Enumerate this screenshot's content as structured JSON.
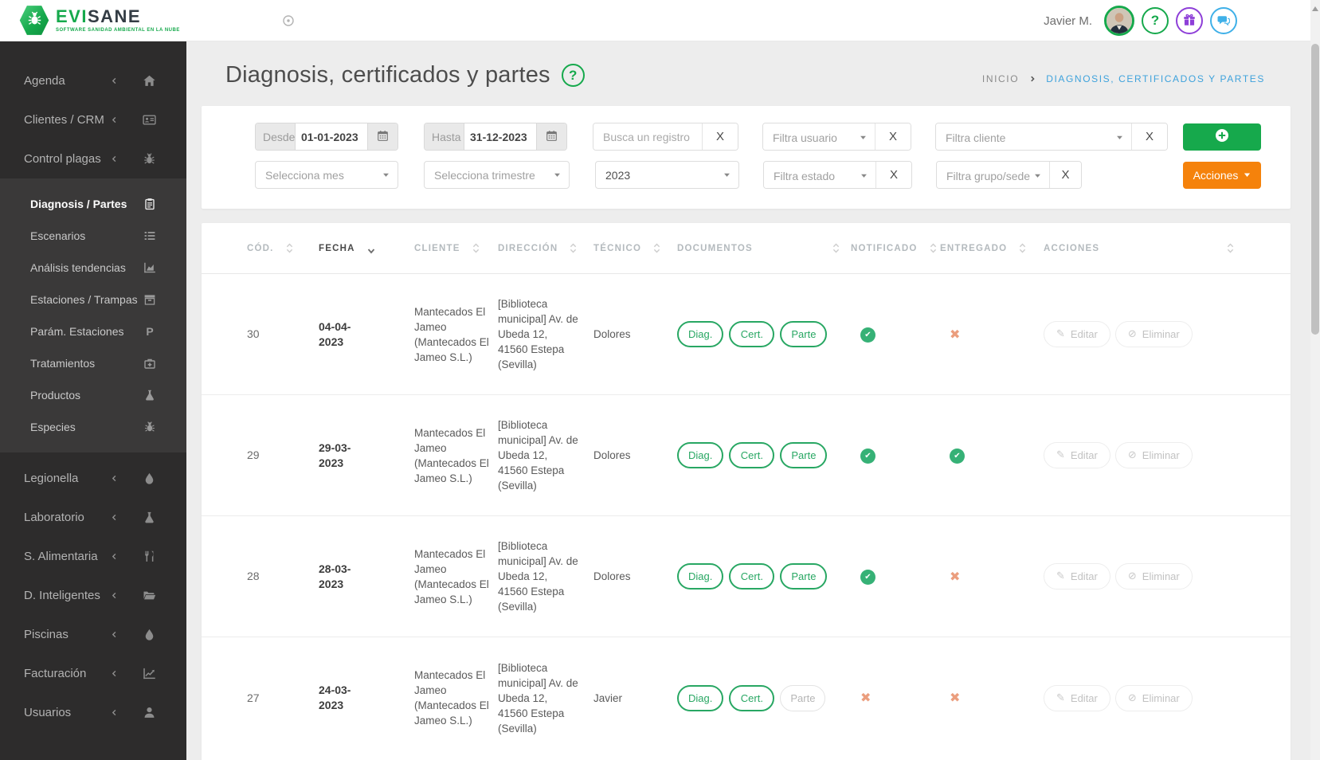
{
  "brand": {
    "name_left": "EVI",
    "name_right": "SANE",
    "tagline": "SOFTWARE SANIDAD AMBIENTAL EN LA NUBE"
  },
  "topbar": {
    "user_name": "Javier M."
  },
  "sidebar": {
    "main_items": [
      {
        "label": "Agenda",
        "icon": "home"
      },
      {
        "label": "Clientes / CRM",
        "icon": "idcard"
      },
      {
        "label": "Control plagas",
        "icon": "bug"
      }
    ],
    "sub_items": [
      {
        "label": "Diagnosis / Partes",
        "icon": "clipboard",
        "active": true
      },
      {
        "label": "Escenarios",
        "icon": "list"
      },
      {
        "label": "Análisis tendencias",
        "icon": "chart-area"
      },
      {
        "label": "Estaciones / Trampas",
        "icon": "box"
      },
      {
        "label": "Parám. Estaciones",
        "icon": "param-p"
      },
      {
        "label": "Tratamientos",
        "icon": "medkit"
      },
      {
        "label": "Productos",
        "icon": "flask"
      },
      {
        "label": "Especies",
        "icon": "bug"
      }
    ],
    "bottom_items": [
      {
        "label": "Legionella",
        "icon": "drop"
      },
      {
        "label": "Laboratorio",
        "icon": "flask"
      },
      {
        "label": "S. Alimentaria",
        "icon": "utensils"
      },
      {
        "label": "D. Inteligentes",
        "icon": "folder"
      },
      {
        "label": "Piscinas",
        "icon": "drop"
      },
      {
        "label": "Facturación",
        "icon": "chart-line"
      },
      {
        "label": "Usuarios",
        "icon": "user"
      }
    ]
  },
  "page": {
    "title": "Diagnosis, certificados y partes",
    "breadcrumb_home": "INICIO",
    "breadcrumb_current": "DIAGNOSIS, CERTIFICADOS Y PARTES"
  },
  "filters": {
    "desde_label": "Desde",
    "desde_value": "01-01-2023",
    "hasta_label": "Hasta",
    "hasta_value": "31-12-2023",
    "search_placeholder": "Busca un registro",
    "clear_label": "X",
    "usuario_placeholder": "Filtra usuario",
    "cliente_placeholder": "Filtra cliente",
    "mes_placeholder": "Selecciona mes",
    "trimestre_placeholder": "Selecciona trimestre",
    "anio_value": "2023",
    "estado_placeholder": "Filtra estado",
    "grupo_placeholder": "Filtra grupo/sede",
    "acciones_label": "Acciones"
  },
  "table": {
    "headers": {
      "cod": "CÓD.",
      "fecha": "FECHA",
      "cliente": "CLIENTE",
      "direccion": "DIRECCIÓN",
      "tecnico": "TÉCNICO",
      "documentos": "DOCUMENTOS",
      "notificado": "NOTIFICADO",
      "entregado": "ENTREGADO",
      "acciones": "ACCIONES"
    },
    "doc_labels": {
      "diag": "Diag.",
      "cert": "Cert.",
      "parte": "Parte"
    },
    "action_labels": {
      "editar": "Editar",
      "eliminar": "Eliminar"
    },
    "rows": [
      {
        "cod": "30",
        "fecha": "04-04-2023",
        "cliente": "Mantecados El Jameo (Mantecados El Jameo S.L.)",
        "direccion": "[Biblioteca municipal] Av. de Ubeda 12, 41560 Estepa (Sevilla)",
        "tecnico": "Dolores",
        "docs": {
          "diag": true,
          "cert": true,
          "parte": true
        },
        "notificado": true,
        "entregado": false
      },
      {
        "cod": "29",
        "fecha": "29-03-2023",
        "cliente": "Mantecados El Jameo (Mantecados El Jameo S.L.)",
        "direccion": "[Biblioteca municipal] Av. de Ubeda 12, 41560 Estepa (Sevilla)",
        "tecnico": "Dolores",
        "docs": {
          "diag": true,
          "cert": true,
          "parte": true
        },
        "notificado": true,
        "entregado": true
      },
      {
        "cod": "28",
        "fecha": "28-03-2023",
        "cliente": "Mantecados El Jameo (Mantecados El Jameo S.L.)",
        "direccion": "[Biblioteca municipal] Av. de Ubeda 12, 41560 Estepa (Sevilla)",
        "tecnico": "Dolores",
        "docs": {
          "diag": true,
          "cert": true,
          "parte": true
        },
        "notificado": true,
        "entregado": false
      },
      {
        "cod": "27",
        "fecha": "24-03-2023",
        "cliente": "Mantecados El Jameo (Mantecados El Jameo S.L.)",
        "direccion": "[Biblioteca municipal] Av. de Ubeda 12, 41560 Estepa (Sevilla)",
        "tecnico": "Javier",
        "docs": {
          "diag": true,
          "cert": true,
          "parte": false
        },
        "notificado": false,
        "entregado": false
      }
    ]
  },
  "colors": {
    "accent_green": "#16a94c",
    "accent_orange": "#f5820b",
    "link_blue": "#3ea2dc",
    "check_green": "#36b176",
    "cross_orange": "#eb9e7e",
    "sidebar_dark": "#2d2c2c"
  }
}
